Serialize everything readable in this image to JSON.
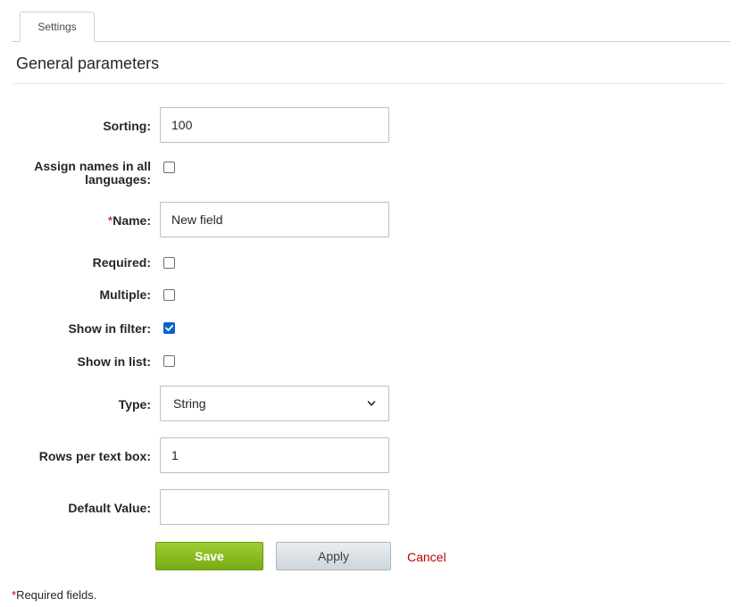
{
  "tabs": [
    {
      "label": "Settings",
      "active": true
    }
  ],
  "section": {
    "title": "General parameters"
  },
  "form": {
    "sorting": {
      "label": "Sorting:",
      "value": "100"
    },
    "assign_names": {
      "label_line1": "Assign names in all",
      "label_line2": "languages:",
      "checked": false
    },
    "name": {
      "star": "*",
      "label": "Name:",
      "value": "New field"
    },
    "required": {
      "label": "Required:",
      "checked": false
    },
    "multiple": {
      "label": "Multiple:",
      "checked": false
    },
    "show_in_filter": {
      "label": "Show in filter:",
      "checked": true
    },
    "show_in_list": {
      "label": "Show in list:",
      "checked": false
    },
    "type": {
      "label": "Type:",
      "value": "String"
    },
    "rows_per_text_box": {
      "label": "Rows per text box:",
      "value": "1"
    },
    "default_value": {
      "label": "Default Value:",
      "value": ""
    }
  },
  "actions": {
    "save": "Save",
    "apply": "Apply",
    "cancel": "Cancel"
  },
  "footer": {
    "star": "*",
    "note": "Required fields."
  },
  "colors": {
    "save_green": "#8cbf26",
    "cancel_red": "#c00000",
    "checkbox_blue": "#0a64c8"
  },
  "icons": {
    "type_dropdown": "chevron-down-icon",
    "checkbox_mark": "checkmark-icon"
  }
}
